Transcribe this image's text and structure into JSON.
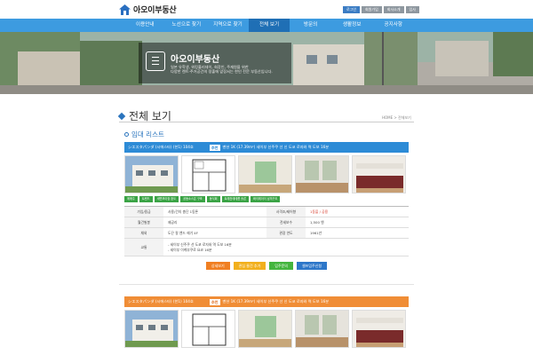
{
  "header": {
    "logo_text": "아오이부동산",
    "top_links": [
      "로그인",
      "회원가입",
      "회사소개",
      "입사"
    ]
  },
  "nav": {
    "items": [
      "이용안내",
      "노선으로 찾기",
      "지역으로 찾기",
      "전체 보기",
      "방문의",
      "생활정보",
      "공지사항"
    ],
    "active_index": 3
  },
  "hero": {
    "title": "아오이부동산",
    "desc_line1": "일본 유학생, 워킹홀리데이, 회장인, 주재원을 위한",
    "desc_line2": "다양한 렌트·주거공간의 정출에 앞장서는 한인 전문 부동산입니다."
  },
  "page": {
    "title": "전체 보기",
    "breadcrumb": "HOME > 전체보기",
    "section": "임대 리스트"
  },
  "listings": [
    {
      "bar_color": "blue",
      "name": "シエスタパンダ (시에스타) (한1) 104호",
      "tag": "추천",
      "summary": "맨션 1K (17.39m²) 세이부 신주쿠 선 신 도코 로자와 역 도보 16분",
      "features": [
        "매매주",
        "트렌드",
        "세면보아장 완도",
        "공동소스은 구조",
        "동식회",
        "트레컨테테름 흘론",
        "화이레아이 남의구도"
      ]
    },
    {
      "bar_color": "orange",
      "name": "シエスタパンダ (시에스타) (한1) 104호",
      "tag": "추천",
      "summary": "맨션 1K (17.39m²) 세이부 신주쿠 선 신 도코 로자와 역 도보 16분"
    }
  ],
  "info": {
    "rows": [
      {
        "k1": "가임/용금",
        "v1": "사용/건의 총단 1동론",
        "k2": "사격조/제어향",
        "v2": "1동을 / 공용"
      },
      {
        "k1": "월건빌봉",
        "v1": "제공리",
        "k2": "전세보수",
        "v2": "1,500 엔"
      },
      {
        "k1": "채외",
        "v1": "도끈 칼 앤드 헤기 4F",
        "k2": "관광 연도",
        "v2": "1961년"
      }
    ],
    "traffic_label": "교통",
    "traffic_lines": [
      "- 세이부 신주쿠 선 도코 로자와 역 도보 16분",
      "- 세이부 이케부쿠로 요코 16분"
    ]
  },
  "actions": [
    "상세보기",
    "관심 물건 추가",
    "입주문의",
    "셀프입주신청"
  ],
  "colors": {
    "nav_blue": "#3d9be0",
    "nav_active": "#1f6fb5",
    "bar_blue": "#2d8bd6",
    "bar_orange": "#f08d36",
    "feature_green": "#3aa345"
  }
}
